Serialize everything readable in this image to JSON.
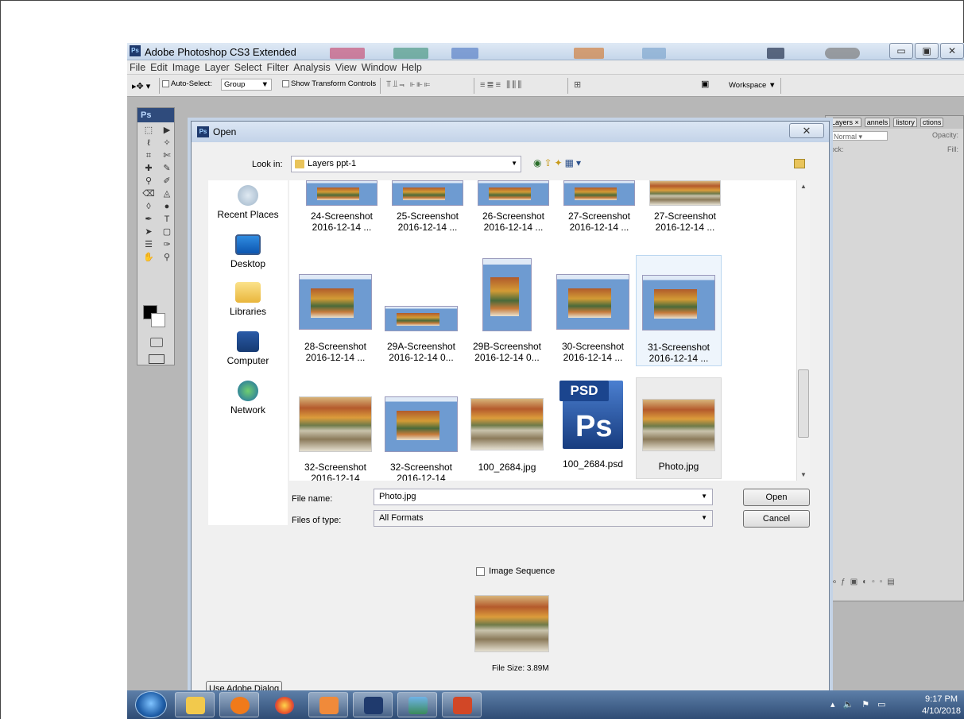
{
  "app": {
    "title": "Adobe Photoshop CS3 Extended",
    "badge": "Ps",
    "window_buttons": [
      "▭",
      "▣",
      "✕"
    ],
    "menu": [
      "File",
      "Edit",
      "Image",
      "Layer",
      "Select",
      "Filter",
      "Analysis",
      "View",
      "Window",
      "Help"
    ],
    "options": {
      "auto_select_label": "Auto-Select:",
      "auto_select_value": "Group",
      "show_transform_label": "Show Transform Controls",
      "workspace_label": "Workspace ▼"
    }
  },
  "tools_panel": {
    "logo": "Ps"
  },
  "layers_panel": {
    "tabs": [
      "Layers ×",
      "annels",
      "listory",
      "ctions"
    ],
    "blend_mode": "Normal",
    "opacity_label": "Opacity:",
    "lock_label": "ock:",
    "fill_label": "Fill:"
  },
  "dialog": {
    "title": "Open",
    "look_in_label": "Look in:",
    "look_in_value": "Layers ppt-1",
    "places": [
      "Recent Places",
      "Desktop",
      "Libraries",
      "Computer",
      "Network"
    ],
    "files": [
      {
        "line1": "24-Screenshot",
        "line2": "2016-12-14 ..."
      },
      {
        "line1": "25-Screenshot",
        "line2": "2016-12-14 ..."
      },
      {
        "line1": "26-Screenshot",
        "line2": "2016-12-14 ..."
      },
      {
        "line1": "27-Screenshot",
        "line2": "2016-12-14 ..."
      },
      {
        "line1": "27-Screenshot",
        "line2": "2016-12-14 ..."
      },
      {
        "line1": "28-Screenshot",
        "line2": "2016-12-14 ..."
      },
      {
        "line1": "29A-Screenshot",
        "line2": "2016-12-14 0..."
      },
      {
        "line1": "29B-Screenshot",
        "line2": "2016-12-14 0..."
      },
      {
        "line1": "30-Screenshot",
        "line2": "2016-12-14 ..."
      },
      {
        "line1": "31-Screenshot",
        "line2": "2016-12-14 ..."
      },
      {
        "line1": "32-Screenshot",
        "line2": "2016-12-14"
      },
      {
        "line1": "32-Screenshot",
        "line2": "2016-12-14"
      },
      {
        "line1": "100_2684.jpg",
        "line2": ""
      },
      {
        "line1": "100_2684.psd",
        "line2": ""
      },
      {
        "line1": "Photo.jpg",
        "line2": ""
      }
    ],
    "psd_icon": {
      "top": "PSD",
      "bottom": "Ps"
    },
    "file_name_label": "File name:",
    "file_name_value": "Photo.jpg",
    "files_of_type_label": "Files of type:",
    "files_of_type_value": "All Formats",
    "open_button": "Open",
    "cancel_button": "Cancel",
    "image_sequence_label": "Image Sequence",
    "file_size": "File Size: 3.89M",
    "adobe_dialog_button": "Use Adobe Dialog"
  },
  "taskbar": {
    "time": "9:17 PM",
    "date": "4/10/2018"
  }
}
